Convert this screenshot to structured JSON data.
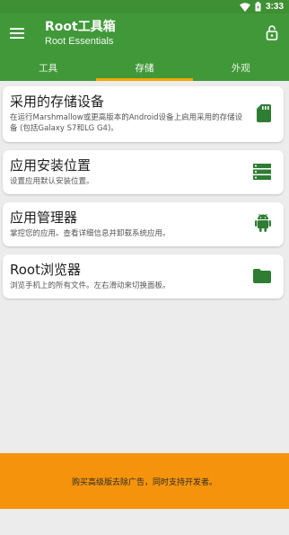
{
  "status_bar": {
    "time": "3:33"
  },
  "app_bar": {
    "title": "Root工具箱",
    "subtitle": "Root Essentials"
  },
  "tabs": [
    {
      "label": "工具",
      "active": false
    },
    {
      "label": "存储",
      "active": true
    },
    {
      "label": "外观",
      "active": false
    }
  ],
  "cards": [
    {
      "title": "采用的存储设备",
      "description": "在运行Marshmallow或更高版本的Android设备上启用采用的存储设备 (包括Galaxy S7和LG G4)。",
      "icon": "sd-card-icon"
    },
    {
      "title": "应用安装位置",
      "description": "设置应用默认安装位置。",
      "icon": "storage-list-icon"
    },
    {
      "title": "应用管理器",
      "description": "掌控您的应用。查看详细信息并卸载系统应用。",
      "icon": "android-icon"
    },
    {
      "title": "Root浏览器",
      "description": "浏览手机上的所有文件。左右滑动来切换面板。",
      "icon": "folder-icon"
    }
  ],
  "promo": {
    "text": "购买高级版去除广告，同时支持开发者。"
  },
  "colors": {
    "primary": "#419839",
    "status_bar": "#3f8f34",
    "tab_indicator": "#f0a800",
    "icon": "#2e7d32",
    "promo_background": "#f5940c",
    "background": "#ececec"
  }
}
